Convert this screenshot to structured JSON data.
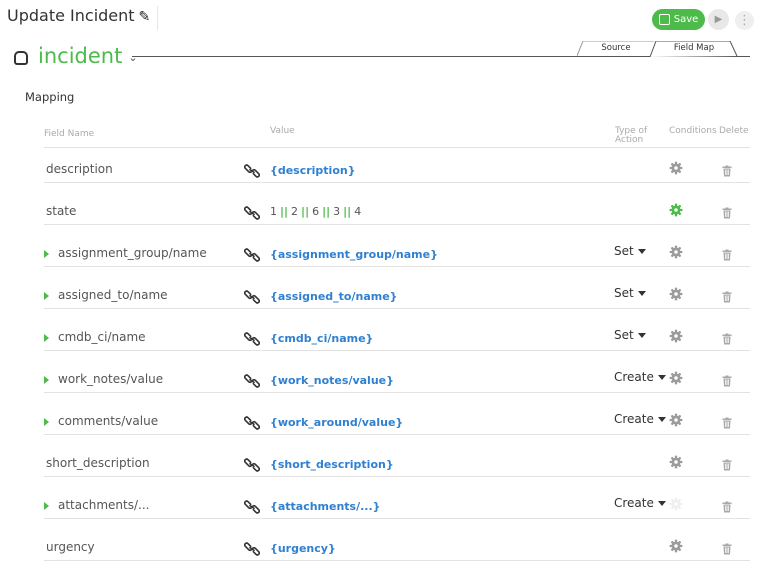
{
  "header": {
    "title": "Update Incident",
    "save_label": "Save",
    "accent_color": "#4cbb4a"
  },
  "record": {
    "name": "incident"
  },
  "tabs": [
    {
      "label": "Source",
      "active": false
    },
    {
      "label": "Field Map",
      "active": true
    }
  ],
  "section": {
    "label": "Mapping"
  },
  "columns": {
    "field_name": "Field Name",
    "value": "Value",
    "type_of_action_1": "Type of",
    "type_of_action_2": "Action",
    "conditions": "Conditions",
    "delete": "Delete"
  },
  "rows": [
    {
      "field": "description",
      "value": "{description}",
      "action": "",
      "expandable": false,
      "condition": "default"
    },
    {
      "field": "state",
      "value_parts": [
        "1",
        "2",
        "6",
        "3",
        "4"
      ],
      "separator": "||",
      "action": "",
      "expandable": false,
      "condition": "active"
    },
    {
      "field": "assignment_group/name",
      "value": "{assignment_group/name}",
      "action": "Set",
      "expandable": true,
      "condition": "default"
    },
    {
      "field": "assigned_to/name",
      "value": "{assigned_to/name}",
      "action": "Set",
      "expandable": true,
      "condition": "default"
    },
    {
      "field": "cmdb_ci/name",
      "value": "{cmdb_ci/name}",
      "action": "Set",
      "expandable": true,
      "condition": "default"
    },
    {
      "field": "work_notes/value",
      "value": "{work_notes/value}",
      "action": "Create",
      "expandable": true,
      "condition": "default"
    },
    {
      "field": "comments/value",
      "value": "{work_around/value}",
      "action": "Create",
      "expandable": true,
      "condition": "default"
    },
    {
      "field": "short_description",
      "value": "{short_description}",
      "action": "",
      "expandable": false,
      "condition": "default"
    },
    {
      "field": "attachments/...",
      "value": "{attachments/...}",
      "action": "Create",
      "expandable": true,
      "condition": "disabled"
    },
    {
      "field": "urgency",
      "value": "{urgency}",
      "action": "",
      "expandable": false,
      "condition": "default"
    }
  ]
}
